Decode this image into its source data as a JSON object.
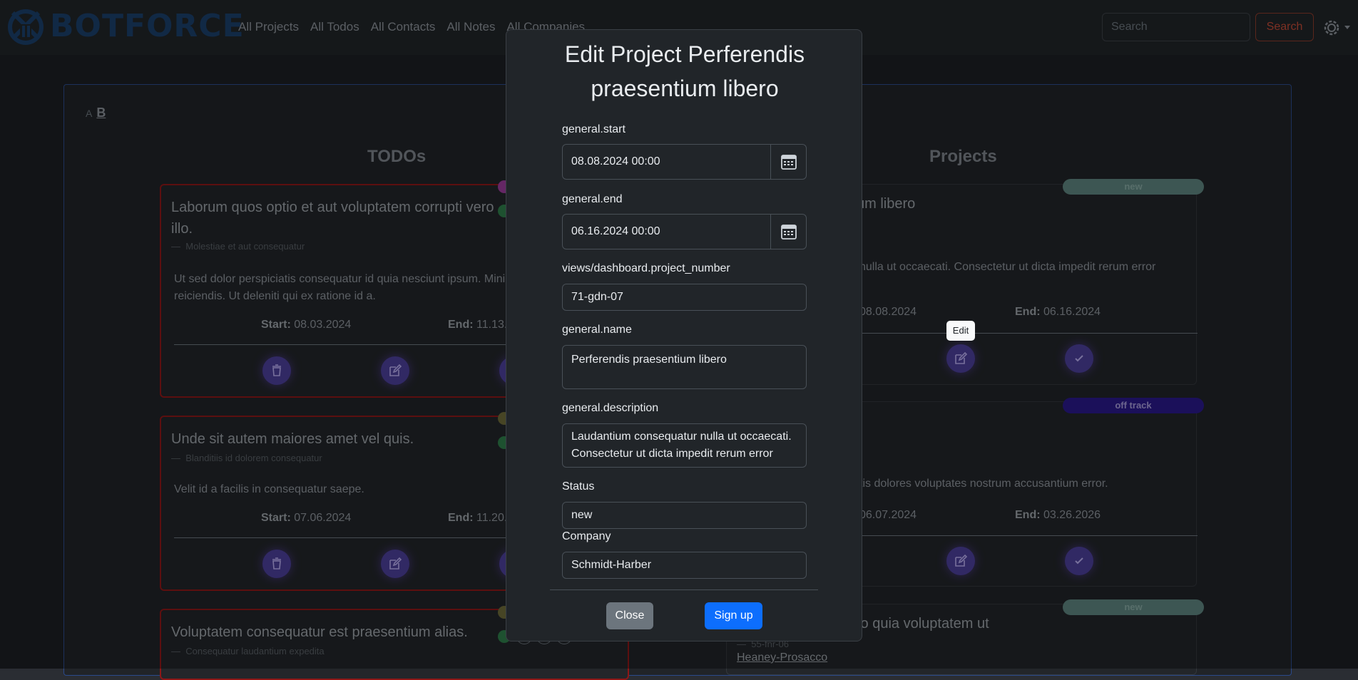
{
  "brand": {
    "name": "BOTFORCE"
  },
  "nav": {
    "links": [
      "All Projects",
      "All Todos",
      "All Contacts",
      "All Notes",
      "All Companies"
    ]
  },
  "search": {
    "placeholder": "Search",
    "button": "Search"
  },
  "view_switch": {
    "a": "A",
    "b": "B"
  },
  "columns": {
    "todos": "TODOs",
    "projects": "Projects"
  },
  "todos": [
    {
      "title": "Laborum quos optio et aut voluptatem corrupti vero illo.",
      "subtitle": "Molestiae et aut consequatur",
      "description": "Ut sed dolor perspiciatis consequatur id quia nesciunt ipsum. Mini incidunt aut et reiciendis. Ut deleniti qui ex ratione id a.",
      "start_label": "Start:",
      "start": "08.03.2024",
      "end_label": "End:",
      "end": "11.13.2"
    },
    {
      "title": "Unde sit autem maiores amet vel quis.",
      "subtitle": "Blanditiis id dolorem consequatur",
      "description": "Velit id a facilis in consequatur saepe.",
      "start_label": "Start:",
      "start": "07.06.2024",
      "end_label": "End:",
      "end": "11.20.2"
    },
    {
      "title": "Voluptatem consequatur est praesentium alias.",
      "subtitle": "Consequatur laudantium expedita"
    }
  ],
  "projects": [
    {
      "status": "new",
      "title_fragment": "tium libero",
      "description": "nulla ut occaecati. Consectetur ut dicta impedit rerum error",
      "description2": ".",
      "start": "08.08.2024",
      "end_label": "End:",
      "end": "06.16.2024",
      "status_color": "#5e8580"
    },
    {
      "status": "off track",
      "description": "tis dolores voluptates nostrum accusantium error.",
      "start": "06.07.2024",
      "end_label": "End:",
      "end": "03.26.2026",
      "status_color": "#2a1a8a"
    },
    {
      "status": "new",
      "title_fragment": "cto quia voluptatem ut",
      "subtitle": "55-fnr-06",
      "company": "Heaney-Prosacco",
      "status_color": "#5e8580"
    }
  ],
  "tooltip": "Edit",
  "modal": {
    "title": "Edit Project Perferendis praesentium libero",
    "start_label": "general.start",
    "start_value": "08.08.2024 00:00",
    "end_label": "general.end",
    "end_value": "06.16.2024 00:00",
    "number_label": "views/dashboard.project_number",
    "number_value": "71-gdn-07",
    "name_label": "general.name",
    "name_value": "Perferendis praesentium libero",
    "description_label": "general.description",
    "description_value": "Laudantium consequatur nulla ut occaecati. Consectetur ut dicta impedit rerum error",
    "status_label": "Status",
    "status_value": "new",
    "company_label": "Company",
    "company_value": "Schmidt-Harber",
    "close_button": "Close",
    "signup_button": "Sign up"
  }
}
